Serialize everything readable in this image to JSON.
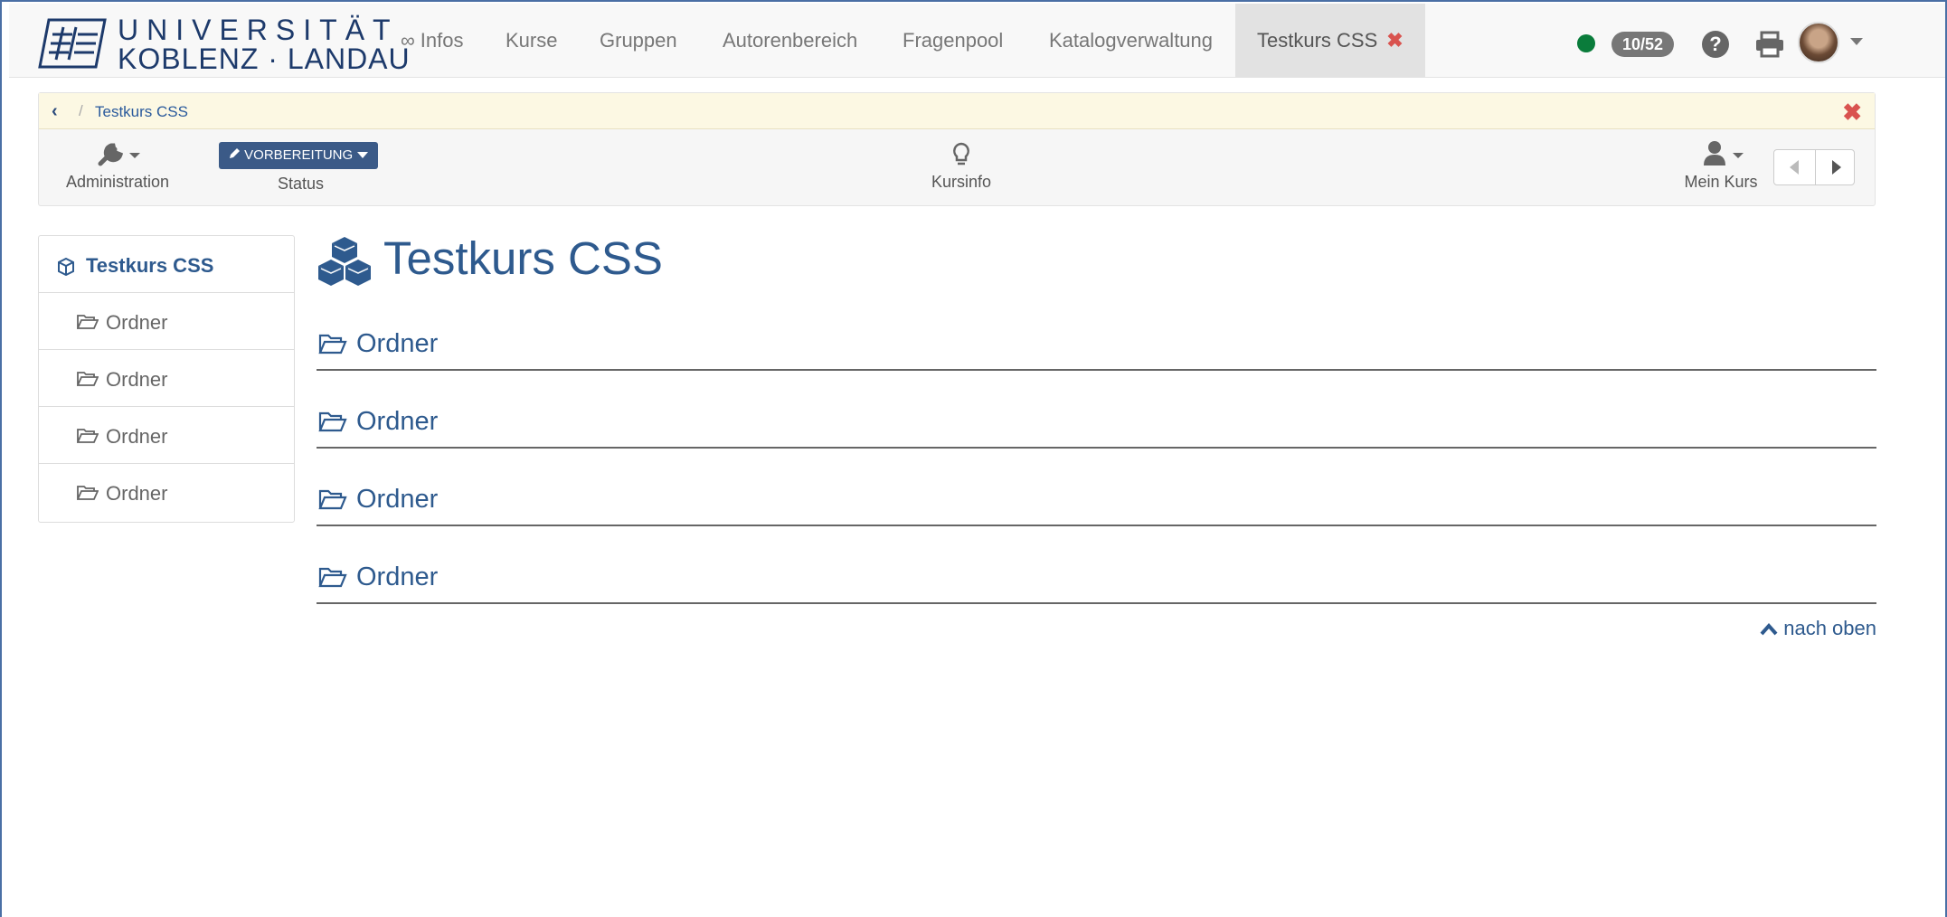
{
  "brand": {
    "line1": "UNIVERSITÄT",
    "line2": "KOBLENZ · LANDAU"
  },
  "nav": {
    "items": [
      "∞ Infos",
      "Kurse",
      "Gruppen",
      "Autorenbereich",
      "Fragenpool",
      "Katalogverwaltung"
    ],
    "active_tab": "Testkurs CSS",
    "active_tab_close": "✖",
    "count_badge": "10/52",
    "help": "?"
  },
  "toolbar": {
    "breadcrumb_back": "‹",
    "breadcrumb_sep": "/",
    "breadcrumb_current": "Testkurs CSS",
    "breadcrumb_close": "✖",
    "administration": "Administration",
    "status_button": "VORBEREITUNG",
    "status_label": "Status",
    "kursinfo": "Kursinfo",
    "mein_kurs": "Mein Kurs"
  },
  "menu": {
    "root": "Testkurs CSS",
    "items": [
      "Ordner",
      "Ordner",
      "Ordner",
      "Ordner"
    ]
  },
  "main": {
    "title": "Testkurs CSS",
    "sections": [
      "Ordner",
      "Ordner",
      "Ordner",
      "Ordner"
    ],
    "to_top": "nach oben"
  },
  "colors": {
    "accent": "#2e5a8e",
    "status_btn": "#3b5a87",
    "close_red": "#d9534f",
    "online_green": "#0a7c3b",
    "breadcrumb_bg": "#fcf8e3"
  }
}
